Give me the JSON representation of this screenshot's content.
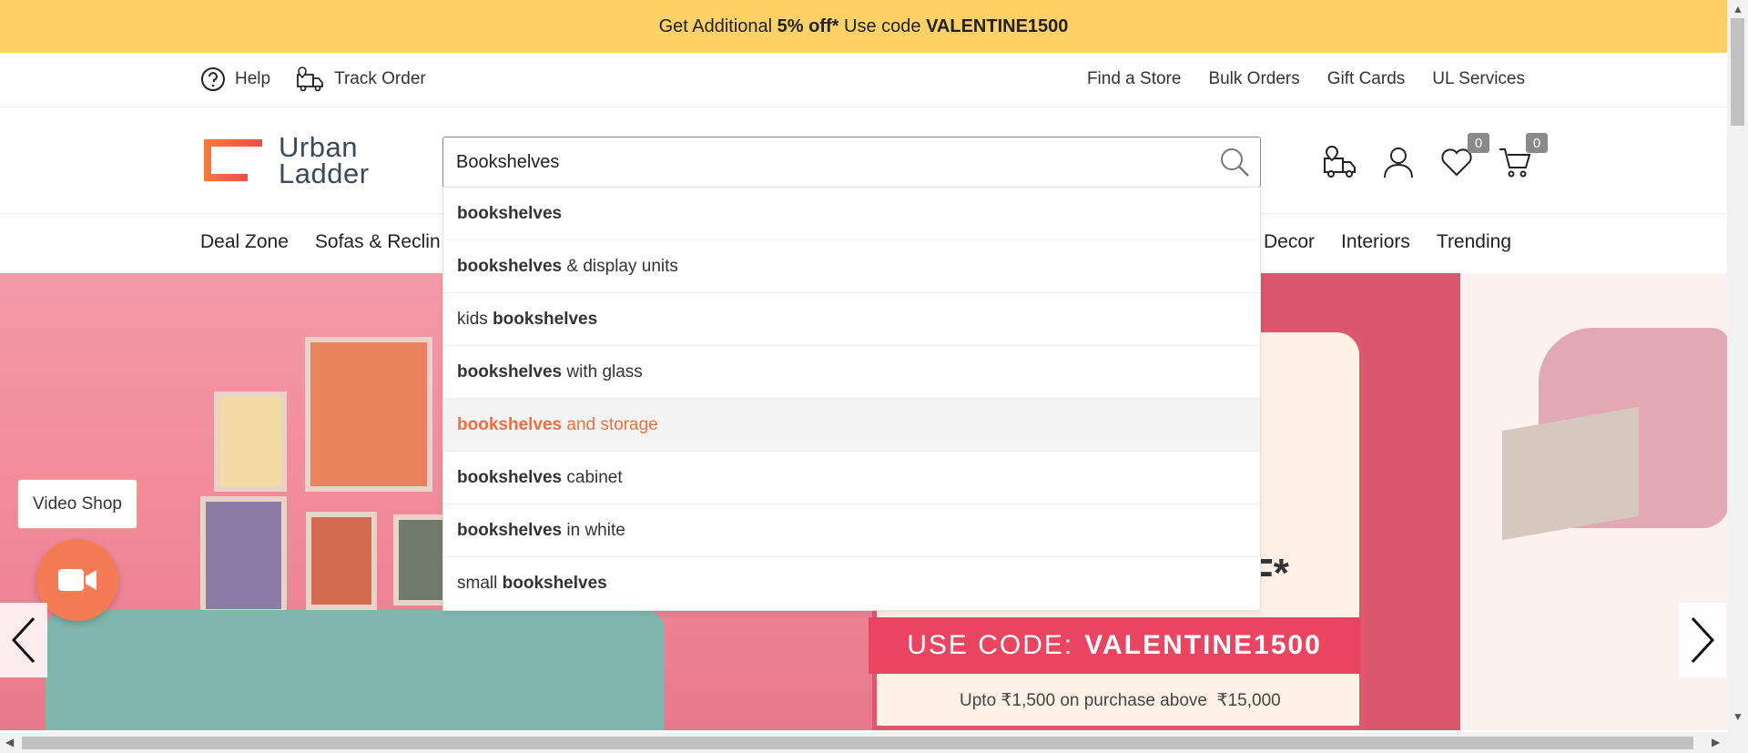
{
  "promo": {
    "prefix": "Get Additional ",
    "bold1": "5% off*",
    "middle": " Use code ",
    "bold2": "VALENTINE1500"
  },
  "util": {
    "help": "Help",
    "track": "Track Order",
    "links": [
      "Find a Store",
      "Bulk Orders",
      "Gift Cards",
      "UL Services"
    ]
  },
  "logo": {
    "line1": "Urban",
    "line2": "Ladder"
  },
  "search": {
    "value": "Bookshelves"
  },
  "header_icons": {
    "wishlist_count": "0",
    "cart_count": "0"
  },
  "nav": {
    "left": [
      "Deal Zone",
      "Sofas & Reclin"
    ],
    "right": [
      "Decor",
      "Interiors",
      "Trending"
    ]
  },
  "suggestions": [
    {
      "pre": "",
      "bold": "bookshelves",
      "post": ""
    },
    {
      "pre": "",
      "bold": "bookshelves",
      "post": " & display units"
    },
    {
      "pre": "kids ",
      "bold": "bookshelves",
      "post": ""
    },
    {
      "pre": "",
      "bold": "bookshelves",
      "post": " with glass"
    },
    {
      "pre": "",
      "bold": "bookshelves",
      "post": " and storage",
      "active": true
    },
    {
      "pre": "",
      "bold": "bookshelves",
      "post": " cabinet"
    },
    {
      "pre": "",
      "bold": "bookshelves",
      "post": " in white"
    },
    {
      "pre": "small ",
      "bold": "bookshelves",
      "post": ""
    }
  ],
  "hero": {
    "code_label": "USE CODE:",
    "code": "VALENTINE1500",
    "offer_fragment": "FF*",
    "terms": "Upto ₹1,500 on purchase above  ₹15,000"
  },
  "video_shop": {
    "label": "Video Shop"
  },
  "colors": {
    "accent": "#f26f3d",
    "promo_bg": "#ffd166",
    "ribbon": "#e94560"
  }
}
